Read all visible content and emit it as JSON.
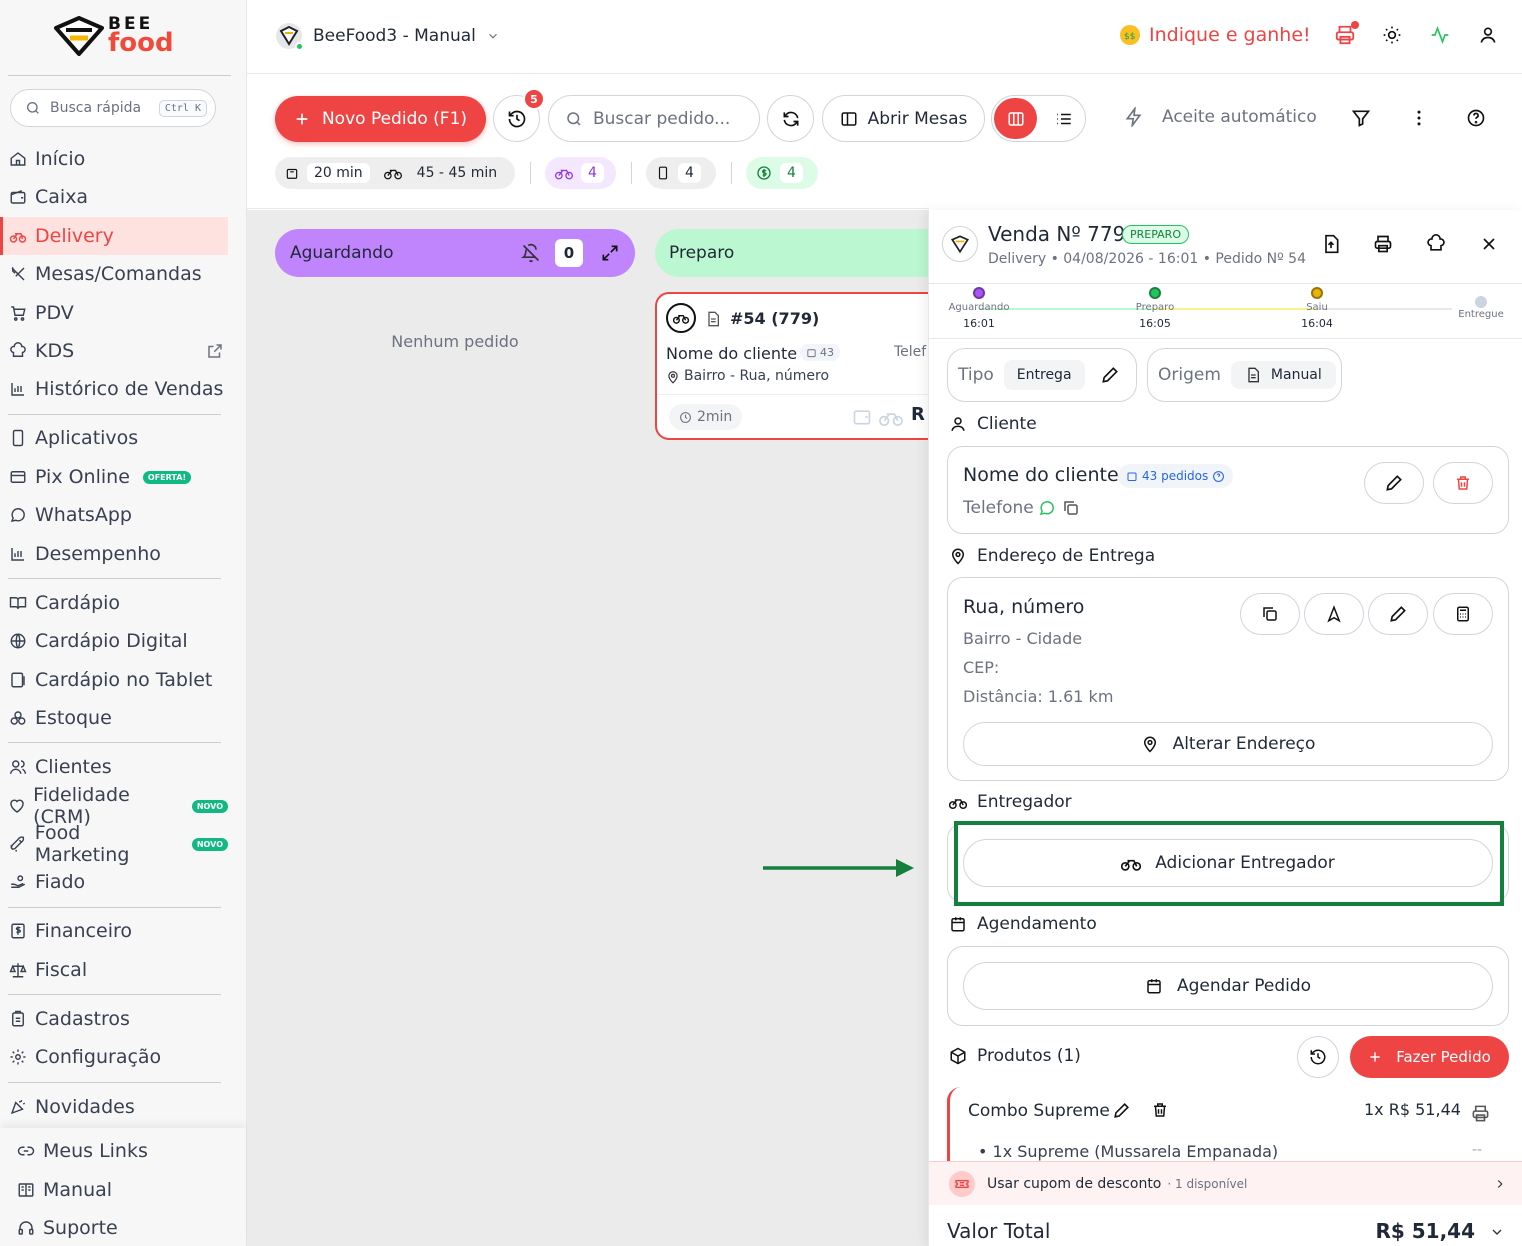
{
  "sidebar": {
    "logo_top": "BEE",
    "logo_bottom": "food",
    "search_placeholder": "Busca rápida",
    "search_shortcut": "Ctrl K",
    "items": [
      {
        "label": "Início",
        "icon": "home-icon"
      },
      {
        "label": "Caixa",
        "icon": "wallet-icon"
      },
      {
        "label": "Delivery",
        "icon": "bike-icon",
        "active": true
      },
      {
        "label": "Mesas/Comandas",
        "icon": "utensils-icon"
      },
      {
        "label": "PDV",
        "icon": "cart-icon"
      },
      {
        "label": "KDS",
        "icon": "chef-hat-icon"
      },
      {
        "label": "Histórico de Vendas",
        "icon": "bar-chart-icon"
      },
      {
        "label": "Aplicativos",
        "icon": "phone-icon"
      },
      {
        "label": "Pix Online",
        "icon": "card-icon",
        "badge": "OFERTA!"
      },
      {
        "label": "WhatsApp",
        "icon": "chat-icon"
      },
      {
        "label": "Desempenho",
        "icon": "bar-chart-icon"
      },
      {
        "label": "Cardápio",
        "icon": "book-icon"
      },
      {
        "label": "Cardápio Digital",
        "icon": "globe-icon"
      },
      {
        "label": "Cardápio no Tablet",
        "icon": "tablet-icon"
      },
      {
        "label": "Estoque",
        "icon": "boxes-icon"
      },
      {
        "label": "Clientes",
        "icon": "users-icon"
      },
      {
        "label": "Fidelidade (CRM)",
        "icon": "heart-icon",
        "badge": "NOVO"
      },
      {
        "label": "Food Marketing",
        "icon": "rocket-icon",
        "badge": "NOVO"
      },
      {
        "label": "Fiado",
        "icon": "hand-coins-icon"
      },
      {
        "label": "Financeiro",
        "icon": "dollar-doc-icon"
      },
      {
        "label": "Fiscal",
        "icon": "scale-icon"
      },
      {
        "label": "Cadastros",
        "icon": "clipboard-icon"
      },
      {
        "label": "Configuração",
        "icon": "gear-icon"
      },
      {
        "label": "Novidades",
        "icon": "party-icon"
      }
    ],
    "bottom": [
      {
        "label": "Meus Links",
        "icon": "link-icon"
      },
      {
        "label": "Manual",
        "icon": "manual-icon"
      },
      {
        "label": "Suporte",
        "icon": "headset-icon"
      }
    ]
  },
  "header": {
    "store_name": "BeeFood3 - Manual",
    "referral": "Indique e ganhe!"
  },
  "toolbar": {
    "new_order": "Novo Pedido (F1)",
    "history_badge": "5",
    "search_placeholder": "Buscar pedido...",
    "open_tables": "Abrir Mesas",
    "auto_accept": "Aceite automático"
  },
  "stats": {
    "prep_time": "20 min",
    "delivery_time": "45 - 45 min",
    "delivery_count": "4",
    "counter_count": "4",
    "paid_count": "4"
  },
  "board": {
    "col_waiting": "Aguardando",
    "col_waiting_count": "0",
    "empty_text": "Nenhum pedido",
    "col_prep": "Preparo",
    "card": {
      "id": "#54 (779)",
      "customer": "Nome do cliente",
      "orders_count": "43",
      "phone_cut": "Telef",
      "address": "Bairro - Rua, número",
      "elapsed": "2min",
      "trail": "R"
    }
  },
  "panel": {
    "title": "Venda Nº 779",
    "status": "PREPARO",
    "subtitle": "Delivery • 04/08/2026 - 16:01 • Pedido Nº 54",
    "timeline": [
      {
        "label": "Aguardando",
        "time": "16:01",
        "color": "#a855f7"
      },
      {
        "label": "Preparo",
        "time": "16:05",
        "color": "#22c55e"
      },
      {
        "label": "Saiu",
        "time": "16:04",
        "color": "#eab308"
      },
      {
        "label": "Entregue",
        "time": "",
        "color": "#cbd5e1"
      }
    ],
    "type_label": "Tipo",
    "type_value": "Entrega",
    "origin_label": "Origem",
    "origin_value": "Manual",
    "customer_section": "Cliente",
    "customer_name": "Nome do cliente",
    "customer_orders": "43 pedidos",
    "customer_phone": "Telefone",
    "address_section": "Endereço de Entrega",
    "street": "Rua, número",
    "district": "Bairro - Cidade",
    "cep": "CEP:",
    "distance": "Distância: 1.61 km",
    "change_address": "Alterar Endereço",
    "courier_section": "Entregador",
    "add_courier": "Adicionar Entregador",
    "schedule_section": "Agendamento",
    "schedule_btn": "Agendar Pedido",
    "products_section": "Produtos (1)",
    "place_order": "Fazer Pedido",
    "product_name": "Combo Supreme",
    "product_price": "1x R$ 51,44",
    "product_sub": "• 1x Supreme (Mussarela Empanada)",
    "product_sub_price": "--",
    "coupon": "Usar cupom de desconto",
    "coupon_avail": "· 1 disponível",
    "total_label": "Valor Total",
    "total_value": "R$ 51,44"
  },
  "colors": {
    "accent": "#ef4444",
    "highlight": "#15803d",
    "waiting": "#c084fc",
    "prep": "#bbf7d0"
  }
}
